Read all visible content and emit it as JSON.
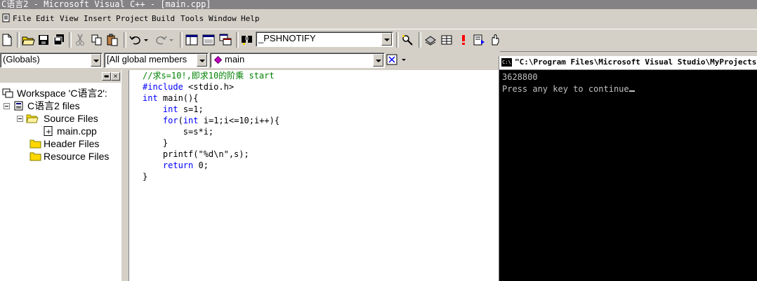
{
  "window": {
    "title": "C语言2 - Microsoft Visual C++ - [main.cpp]"
  },
  "menu": {
    "items": [
      "File",
      "Edit",
      "View",
      "Insert",
      "Project",
      "Build",
      "Tools",
      "Window",
      "Help"
    ]
  },
  "toolbar": {
    "class_combo": "_PSHNOTIFY",
    "icons": [
      "new-file-icon",
      "open-icon",
      "save-icon",
      "save-all-icon",
      "cut-icon",
      "copy-icon",
      "paste-icon",
      "undo-icon",
      "redo-icon",
      "workspace-icon",
      "output-icon",
      "window-list-icon",
      "find-in-files-icon",
      "find-icon",
      "compile-icon",
      "build-icon",
      "stop-build-icon",
      "execute-icon",
      "go-icon",
      "breakpoint-icon"
    ]
  },
  "wizardbar": {
    "scope": "(Globals)",
    "members": "[All global members",
    "function": "main"
  },
  "workspace": {
    "root": "Workspace 'C语言2':",
    "project": "C语言2 files",
    "source_folder": "Source Files",
    "source_file": "main.cpp",
    "header_folder": "Header Files",
    "resource_folder": "Resource Files"
  },
  "editor": {
    "lines": [
      {
        "parts": [
          {
            "t": "//求s=10!,即求10的阶乘 start",
            "c": "cm"
          }
        ]
      },
      {
        "parts": [
          {
            "t": "#include",
            "c": "kw"
          },
          {
            "t": " <stdio.h>",
            "c": ""
          }
        ]
      },
      {
        "parts": [
          {
            "t": "int",
            "c": "kw"
          },
          {
            "t": " main(){",
            "c": ""
          }
        ]
      },
      {
        "parts": [
          {
            "t": "    ",
            "c": ""
          },
          {
            "t": "int",
            "c": "kw"
          },
          {
            "t": " s=1;",
            "c": ""
          }
        ]
      },
      {
        "parts": [
          {
            "t": "    ",
            "c": ""
          },
          {
            "t": "for",
            "c": "kw"
          },
          {
            "t": "(",
            "c": ""
          },
          {
            "t": "int",
            "c": "kw"
          },
          {
            "t": " i=1;i<=10;i++){",
            "c": ""
          }
        ]
      },
      {
        "parts": [
          {
            "t": "        s=s*i;",
            "c": ""
          }
        ]
      },
      {
        "parts": [
          {
            "t": "    }",
            "c": ""
          }
        ]
      },
      {
        "parts": [
          {
            "t": "    printf(\"%d\\n\",s);",
            "c": ""
          }
        ]
      },
      {
        "parts": [
          {
            "t": "    ",
            "c": ""
          },
          {
            "t": "return",
            "c": "kw"
          },
          {
            "t": " 0;",
            "c": ""
          }
        ]
      },
      {
        "parts": [
          {
            "t": "}",
            "c": ""
          }
        ]
      }
    ]
  },
  "console": {
    "title": "\"C:\\Program Files\\Microsoft Visual Studio\\MyProjects",
    "icon": "C:\\",
    "output_line1": "3628800",
    "output_line2": "Press any key to continue"
  },
  "colors": {
    "keyword": "#0000ff",
    "comment": "#008000",
    "chrome": "#d4d0c8"
  }
}
